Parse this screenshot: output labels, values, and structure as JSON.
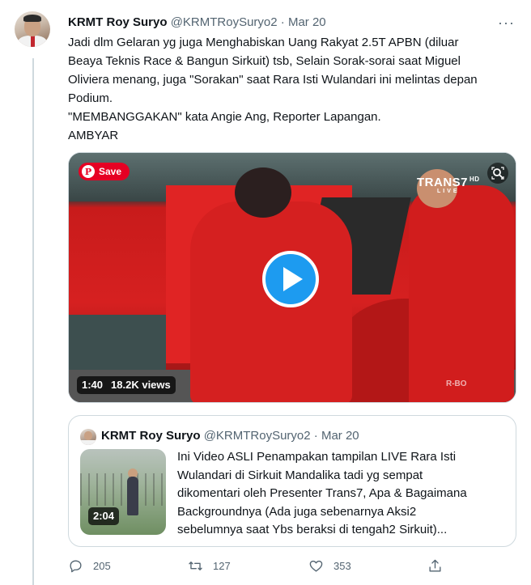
{
  "tweet": {
    "author_name": "KRMT Roy Suryo",
    "handle": "@KRMTRoySuryo2",
    "separator": "·",
    "date": "Mar 20",
    "more": "···",
    "text_lines": [
      "Jadi dlm Gelaran yg juga Menghabiskan Uang Rakyat 2.5T APBN (diluar",
      "Beaya Teknis Race & Bangun Sirkuit) tsb, Selain Sorak-sorai saat Miguel",
      "Oliviera menang, juga \"Sorakan\" saat Rara Isti Wulandari ini melintas depan",
      "Podium.",
      "\"MEMBANGGAKAN\" kata Angie Ang, Reporter Lapangan.",
      "AMBYAR"
    ]
  },
  "video": {
    "save_label": "Save",
    "pinterest_icon": "P",
    "broadcaster": "TRANS7",
    "broadcaster_live": "LIVE",
    "broadcaster_hd": "HD",
    "duration": "1:40",
    "views": "18.2K views",
    "watermark": "R-BO"
  },
  "quoted": {
    "author_name": "KRMT Roy Suryo",
    "handle": "@KRMTRoySuryo2",
    "separator": "·",
    "date": "Mar 20",
    "thumb_duration": "2:04",
    "text_lines": [
      "Ini Video ASLI Penampakan tampilan LIVE Rara Isti",
      "Wulandari di Sirkuit Mandalika tadi yg sempat",
      "dikomentari oleh Presenter Trans7, Apa & Bagaimana",
      "Backgroundnya (Ada juga sebenarnya Aksi2",
      "sebelumnya saat Ybs beraksi di tengah2 Sirkuit)..."
    ]
  },
  "actions": {
    "replies": "205",
    "retweets": "127",
    "likes": "353"
  },
  "colors": {
    "accent": "#1d9bf0",
    "secondary_text": "#536471",
    "pinterest": "#e60023"
  }
}
